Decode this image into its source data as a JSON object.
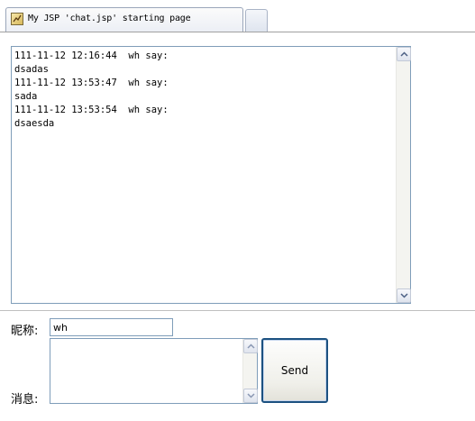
{
  "browser": {
    "tab_title": "My JSP 'chat.jsp' starting page",
    "tab_icon": "page-icon"
  },
  "chat": {
    "log_lines": [
      "111-11-12 12:16:44  wh say:",
      "dsadas",
      "111-11-12 13:53:47  wh say:",
      "sada",
      "111-11-12 13:53:54  wh say:",
      "dsaesda"
    ]
  },
  "form": {
    "nickname_label": "昵称:",
    "nickname_value": "wh",
    "message_label": "消息:",
    "message_value": "",
    "send_label": "Send"
  }
}
